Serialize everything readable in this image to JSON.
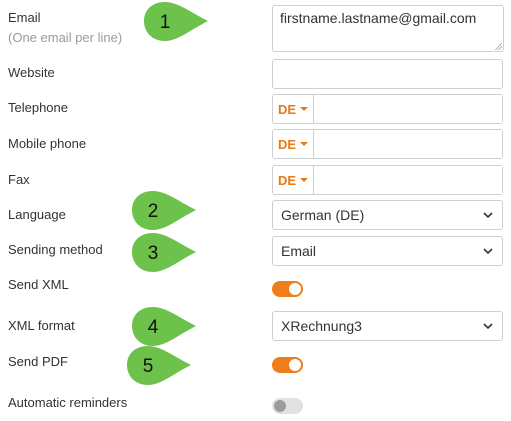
{
  "form": {
    "email": {
      "label": "Email",
      "sublabel": "(One email per line)",
      "value": "firstname.lastname@gmail.com"
    },
    "website": {
      "label": "Website",
      "value": ""
    },
    "telephone": {
      "label": "Telephone",
      "country": "DE",
      "value": ""
    },
    "mobile": {
      "label": "Mobile phone",
      "country": "DE",
      "value": ""
    },
    "fax": {
      "label": "Fax",
      "country": "DE",
      "value": ""
    },
    "language": {
      "label": "Language",
      "value": "German (DE)"
    },
    "sending_method": {
      "label": "Sending method",
      "value": "Email"
    },
    "send_xml": {
      "label": "Send XML",
      "enabled": true
    },
    "xml_format": {
      "label": "XML format",
      "value": "XRechnung3"
    },
    "send_pdf": {
      "label": "Send PDF",
      "enabled": true
    },
    "auto_reminders": {
      "label": "Automatic reminders",
      "enabled": false
    }
  },
  "callouts": [
    "1",
    "2",
    "3",
    "4",
    "5"
  ],
  "colors": {
    "accent": "#ef7d1a",
    "callout": "#6cc24a",
    "toggle_off": "#e2e2e2"
  }
}
